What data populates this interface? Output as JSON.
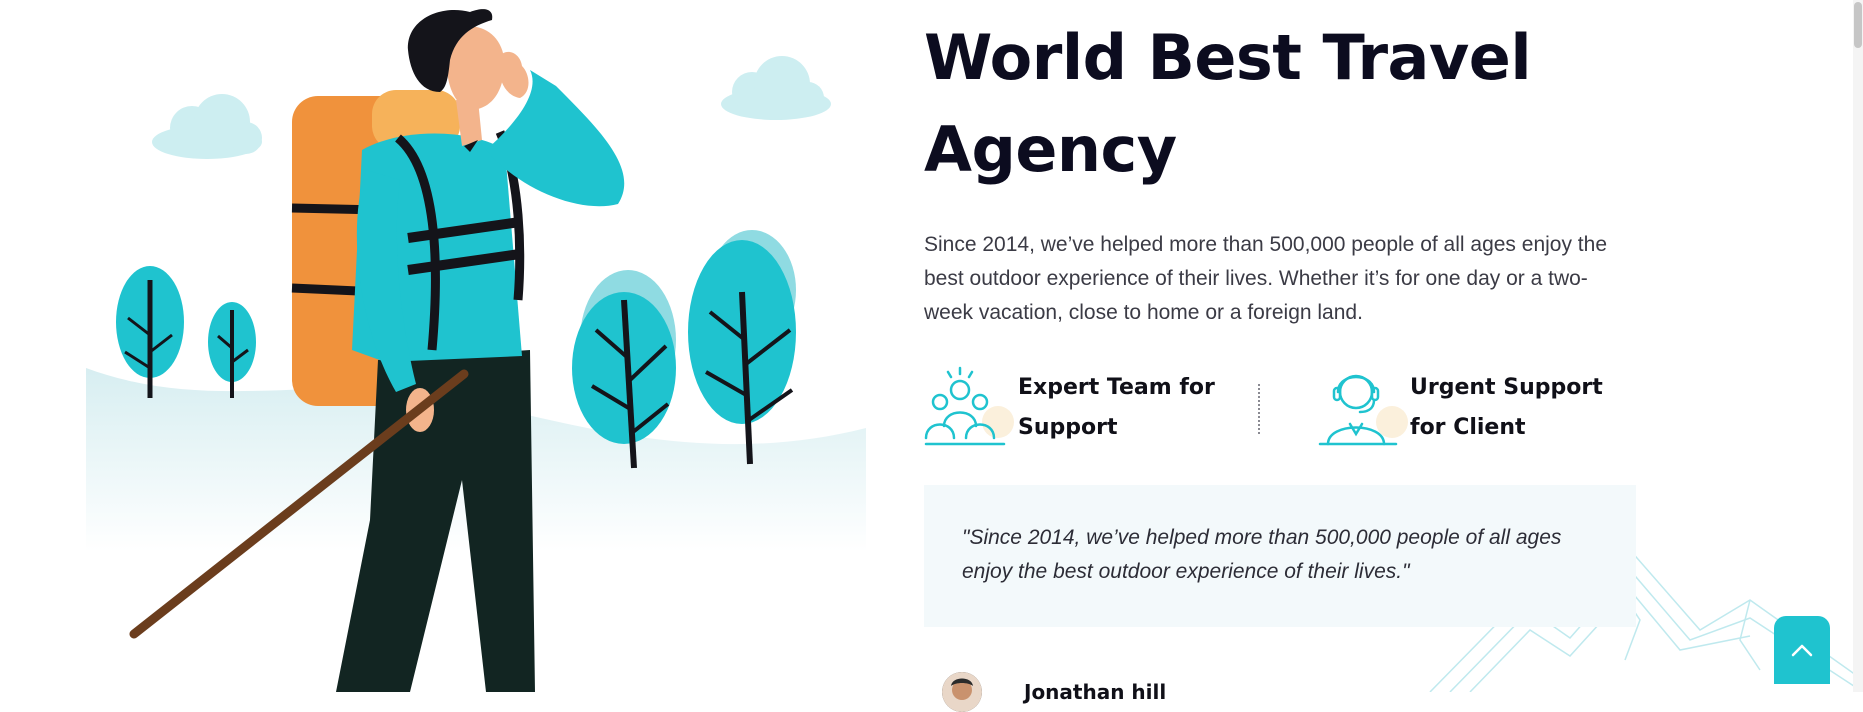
{
  "hero": {
    "title": "World Best Travel Agency",
    "description": "Since 2014, we’ve helped more than 500,000 people of all ages enjoy the best outdoor experience of their lives. Whether it’s for one day or a two-week vacation, close to home or a foreign land."
  },
  "features": [
    {
      "label": "Expert Team for Support",
      "icon": "team-icon"
    },
    {
      "label": "Urgent Support for Client",
      "icon": "support-agent-icon"
    }
  ],
  "quote": {
    "text": "\"Since 2014, we’ve helped more than 500,000 people of all ages enjoy the best outdoor experience of their lives.\""
  },
  "author": {
    "name": "Jonathan hill"
  },
  "colors": {
    "accent": "#1fc3cf",
    "orange": "#f0923c",
    "dark": "#0c0c1f",
    "quote_bg": "#f3f9fb"
  },
  "scroll_top": {
    "icon": "chevron-up-icon"
  }
}
